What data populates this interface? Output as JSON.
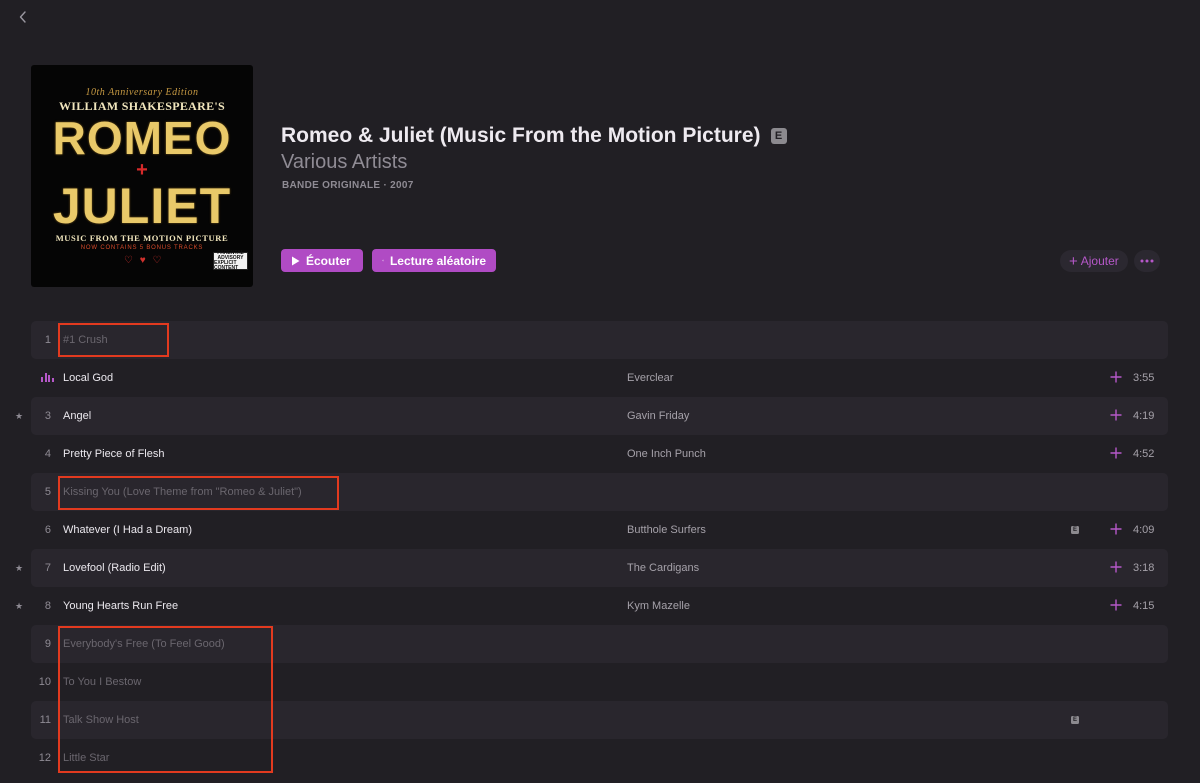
{
  "nav": {
    "back_icon": "chevron-left-icon"
  },
  "cover": {
    "edition": "10th Anniversary Edition",
    "line1": "WILLIAM SHAKESPEARE'S",
    "word1": "ROMEO",
    "cross": "+",
    "word2": "JULIET",
    "sub1": "MUSIC FROM THE MOTION PICTURE",
    "sub2": "NOW CONTAINS 5 BONUS TRACKS",
    "advisory1": "PARENTAL",
    "advisory2": "ADVISORY",
    "advisory3": "EXPLICIT CONTENT"
  },
  "album": {
    "title": "Romeo & Juliet (Music From the Motion Picture)",
    "explicit": "E",
    "artist": "Various Artists",
    "meta": "BANDE ORIGINALE · 2007"
  },
  "actions": {
    "play_label": "Écouter",
    "shuffle_label": "Lecture aléatoire",
    "add_label": "Ajouter"
  },
  "colors": {
    "accent": "#b04bc4",
    "background": "#211f24",
    "highlight": "#e23a1f"
  },
  "tracks": [
    {
      "num": "1",
      "title": "#1 Crush",
      "artist": "",
      "duration": "",
      "available": false,
      "playing": false,
      "starred": false,
      "explicit": false
    },
    {
      "num": "2",
      "title": "Local God",
      "artist": "Everclear",
      "duration": "3:55",
      "available": true,
      "playing": true,
      "starred": false,
      "explicit": false
    },
    {
      "num": "3",
      "title": "Angel",
      "artist": "Gavin Friday",
      "duration": "4:19",
      "available": true,
      "playing": false,
      "starred": true,
      "explicit": false
    },
    {
      "num": "4",
      "title": "Pretty Piece of Flesh",
      "artist": "One Inch Punch",
      "duration": "4:52",
      "available": true,
      "playing": false,
      "starred": false,
      "explicit": false
    },
    {
      "num": "5",
      "title": "Kissing You (Love Theme from \"Romeo & Juliet\")",
      "artist": "",
      "duration": "",
      "available": false,
      "playing": false,
      "starred": false,
      "explicit": false
    },
    {
      "num": "6",
      "title": "Whatever (I Had a Dream)",
      "artist": "Butthole Surfers",
      "duration": "4:09",
      "available": true,
      "playing": false,
      "starred": false,
      "explicit": true
    },
    {
      "num": "7",
      "title": "Lovefool (Radio Edit)",
      "artist": "The Cardigans",
      "duration": "3:18",
      "available": true,
      "playing": false,
      "starred": true,
      "explicit": false
    },
    {
      "num": "8",
      "title": "Young Hearts Run Free",
      "artist": "Kym Mazelle",
      "duration": "4:15",
      "available": true,
      "playing": false,
      "starred": true,
      "explicit": false
    },
    {
      "num": "9",
      "title": "Everybody's Free (To Feel Good)",
      "artist": "",
      "duration": "",
      "available": false,
      "playing": false,
      "starred": false,
      "explicit": false
    },
    {
      "num": "10",
      "title": "To You I Bestow",
      "artist": "",
      "duration": "",
      "available": false,
      "playing": false,
      "starred": false,
      "explicit": false
    },
    {
      "num": "11",
      "title": "Talk Show Host",
      "artist": "",
      "duration": "",
      "available": false,
      "playing": false,
      "starred": false,
      "explicit": true
    },
    {
      "num": "12",
      "title": "Little Star",
      "artist": "",
      "duration": "",
      "available": false,
      "playing": false,
      "starred": false,
      "explicit": false
    }
  ],
  "icons": {
    "star": "★",
    "explicit": "E"
  }
}
